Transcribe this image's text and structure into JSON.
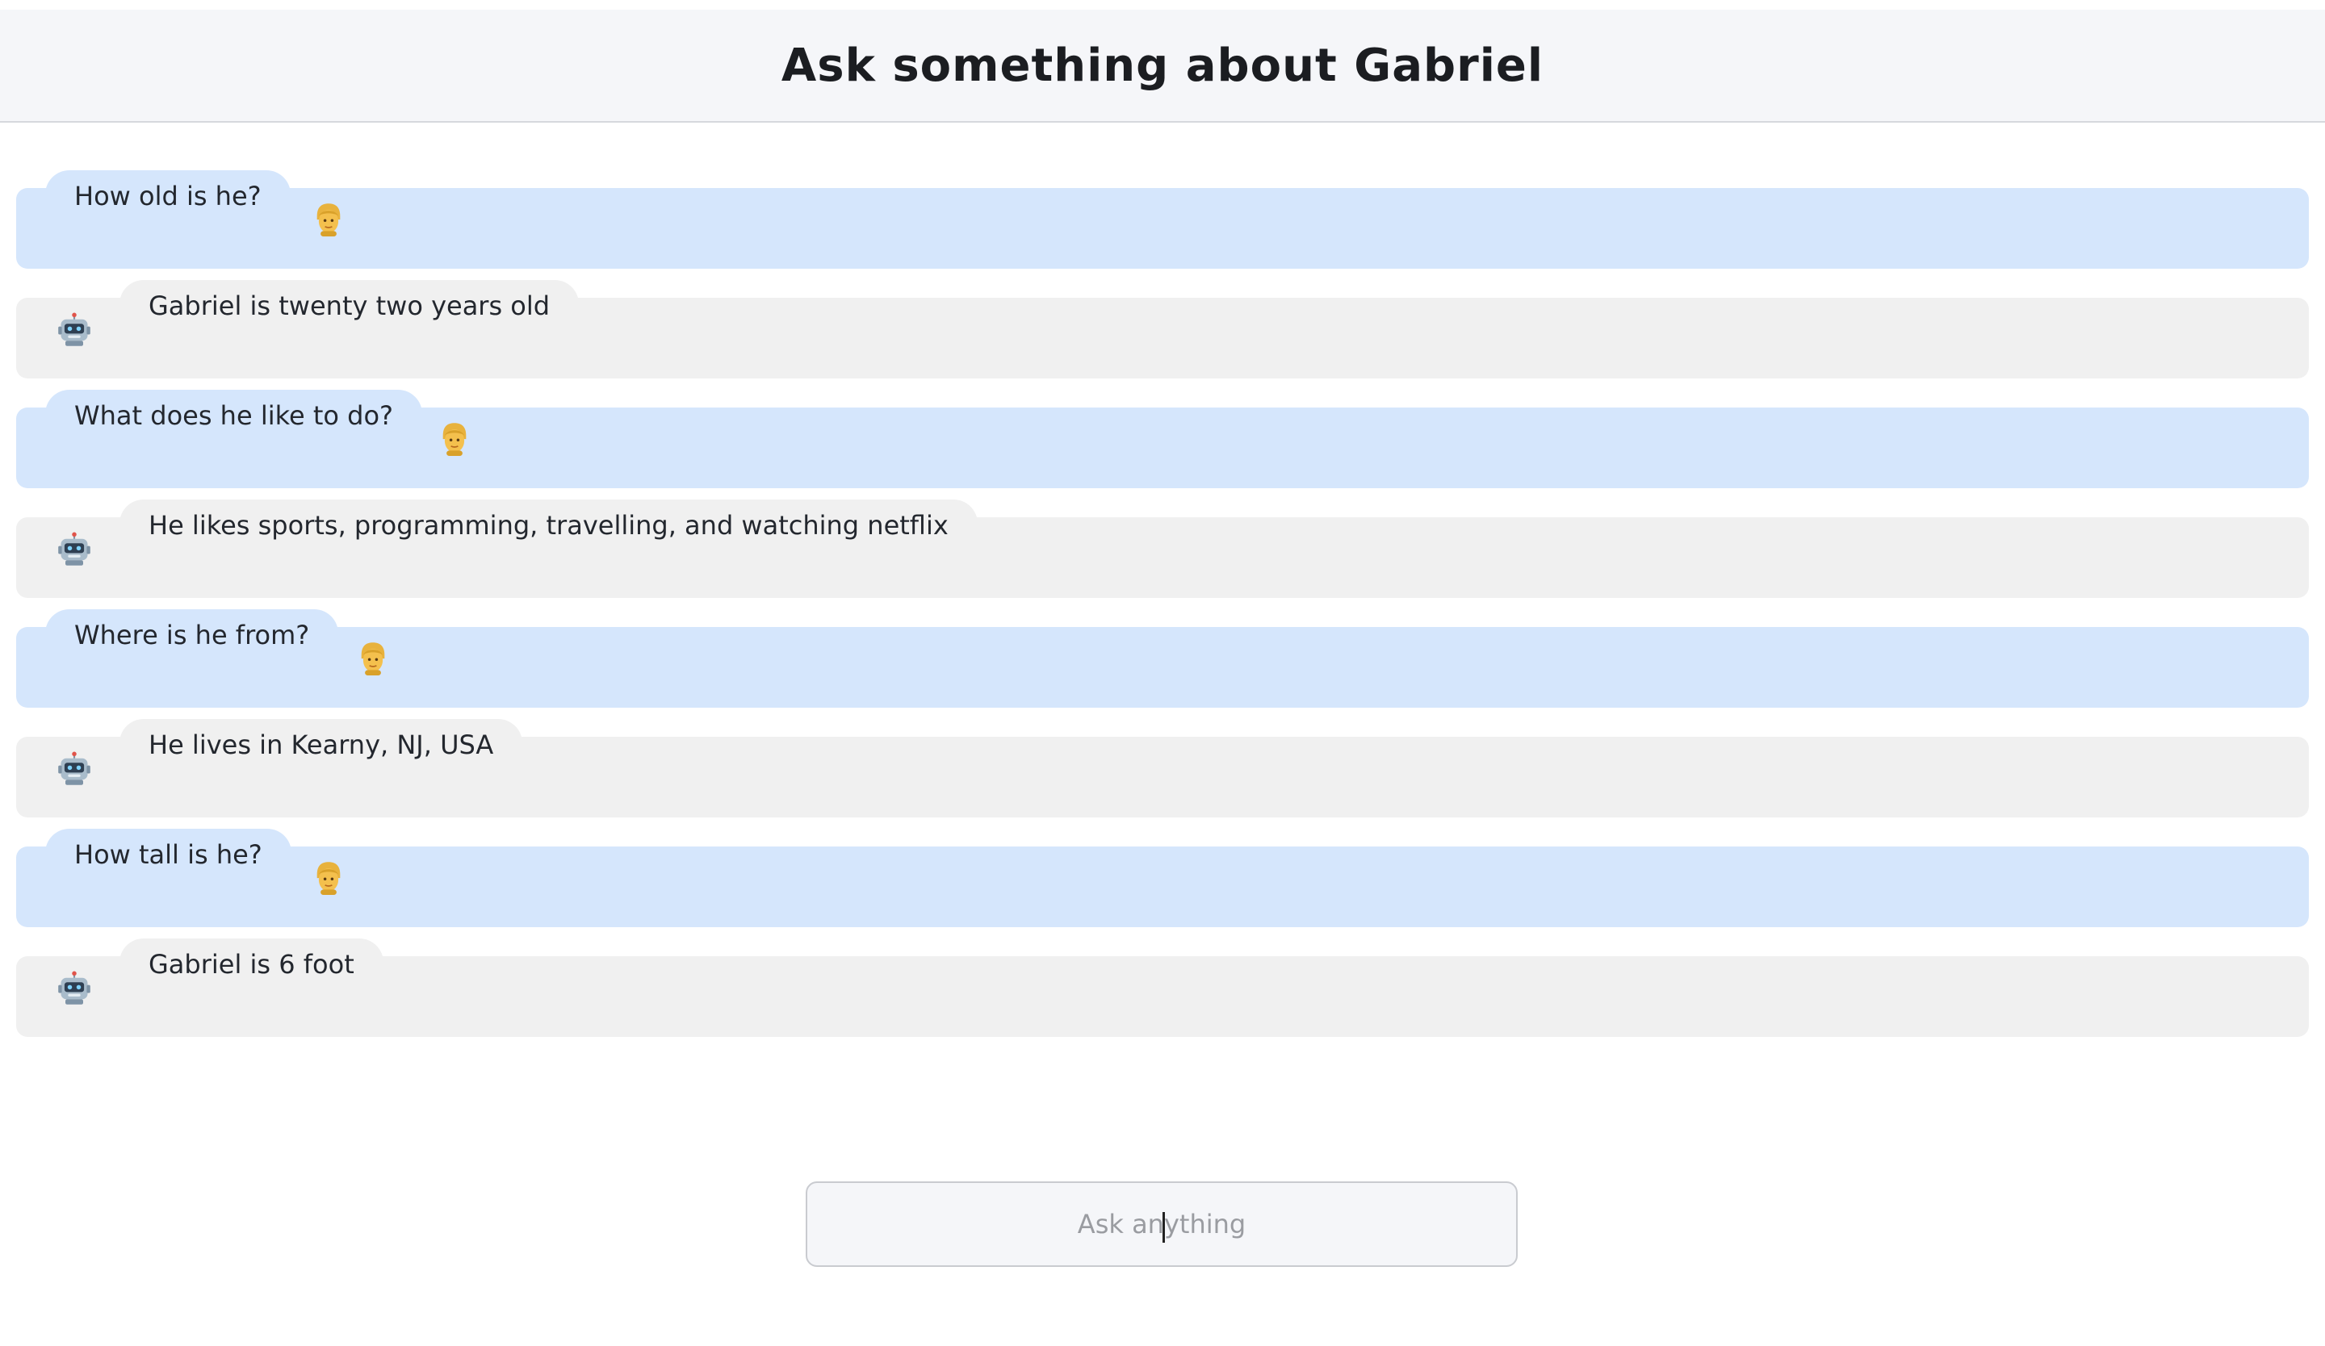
{
  "header": {
    "title": "Ask something about Gabriel"
  },
  "messages": [
    {
      "role": "user",
      "text": "How old is he?",
      "icon": "man-emoji-icon"
    },
    {
      "role": "bot",
      "text": "Gabriel is twenty two years old",
      "icon": "robot-emoji-icon"
    },
    {
      "role": "user",
      "text": "What does he like to do?",
      "icon": "man-emoji-icon"
    },
    {
      "role": "bot",
      "text": "He likes sports, programming, travelling, and watching netflix",
      "icon": "robot-emoji-icon"
    },
    {
      "role": "user",
      "text": "Where is he from?",
      "icon": "man-emoji-icon"
    },
    {
      "role": "bot",
      "text": "He lives in Kearny, NJ, USA",
      "icon": "robot-emoji-icon"
    },
    {
      "role": "user",
      "text": "How tall is he?",
      "icon": "man-emoji-icon"
    },
    {
      "role": "bot",
      "text": "Gabriel is 6 foot",
      "icon": "robot-emoji-icon"
    }
  ],
  "input": {
    "placeholder": "Ask anything",
    "value": ""
  },
  "colors": {
    "user_bubble": "#d5e6fc",
    "bot_bubble": "#f0f0f0",
    "header_bg": "#f5f6f9"
  }
}
